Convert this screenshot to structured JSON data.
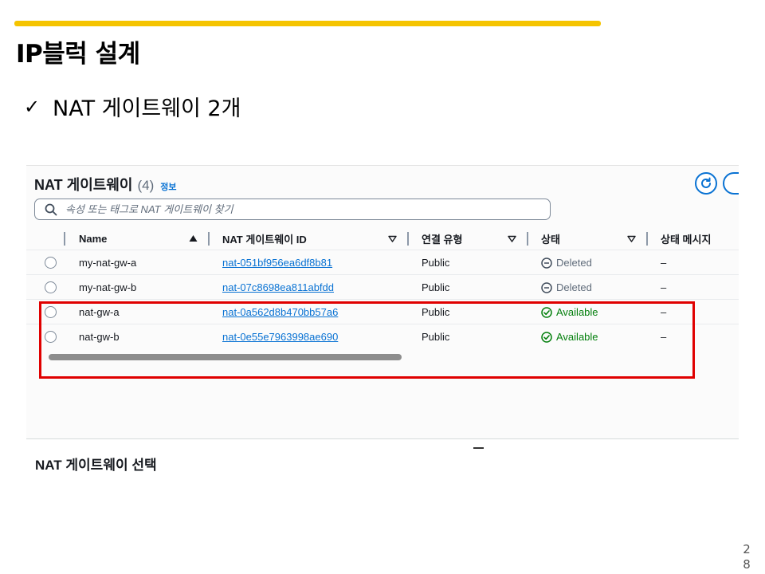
{
  "slide": {
    "title": "IP블럭 설계",
    "bullet_mark": "✓",
    "bullet_text": "NAT 게이트웨이 2개",
    "page_number": "2 8"
  },
  "console": {
    "panel_title": "NAT 게이트웨이",
    "panel_count": "(4)",
    "info_link": "정보",
    "search_placeholder": "속성 또는 태그로 NAT 게이트웨이 찾기",
    "columns": [
      "Name",
      "NAT 게이트웨이 ID",
      "연결 유형",
      "상태",
      "상태 메시지"
    ],
    "rows": [
      {
        "name": "my-nat-gw-a",
        "id": "nat-051bf956ea6df8b81",
        "type": "Public",
        "status": "Deleted",
        "message": "–"
      },
      {
        "name": "my-nat-gw-b",
        "id": "nat-07c8698ea811abfdd",
        "type": "Public",
        "status": "Deleted",
        "message": "–"
      },
      {
        "name": "nat-gw-a",
        "id": "nat-0a562d8b470bb57a6",
        "type": "Public",
        "status": "Available",
        "message": "–"
      },
      {
        "name": "nat-gw-b",
        "id": "nat-0e55e7963998ae690",
        "type": "Public",
        "status": "Available",
        "message": "–"
      }
    ],
    "detail_title": "NAT 게이트웨이 선택"
  },
  "colors": {
    "accent_bar": "#f5c400",
    "highlight": "#e00000",
    "link": "#0972d3",
    "available": "#037f0c",
    "deleted": "#5f6b7a"
  }
}
